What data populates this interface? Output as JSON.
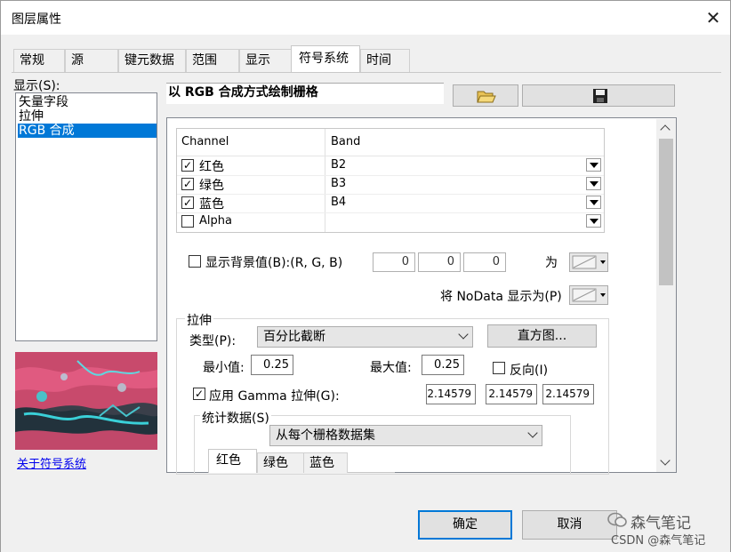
{
  "window": {
    "title": "图层属性",
    "close_glyph": "✕"
  },
  "tabs": [
    "常规",
    "源",
    "键元数据",
    "范围",
    "显示",
    "符号系统",
    "时间"
  ],
  "active_tab": "符号系统",
  "show": {
    "label": "显示(S):",
    "items": [
      "矢量字段",
      "拉伸",
      "RGB 合成"
    ],
    "selected": "RGB 合成"
  },
  "about_link": "关于符号系统",
  "heading": "以 RGB 合成方式绘制栅格",
  "toolbar": {
    "open_icon": "folder-open-icon",
    "save_icon": "save-icon"
  },
  "channels": {
    "col_channel": "Channel",
    "col_band": "Band",
    "rows": [
      {
        "name": "红色",
        "band": "B2",
        "checked": true
      },
      {
        "name": "绿色",
        "band": "B3",
        "checked": true
      },
      {
        "name": "蓝色",
        "band": "B4",
        "checked": true
      },
      {
        "name": "Alpha",
        "band": "",
        "checked": false
      }
    ]
  },
  "background": {
    "label": "显示背景值(B):(R, G, B)",
    "checked": false,
    "r": "0",
    "g": "0",
    "b": "0",
    "as_label": "为"
  },
  "nodata": {
    "label": "将 NoData 显示为(P)"
  },
  "stretch": {
    "group": "拉伸",
    "type_label": "类型(P):",
    "type_value": "百分比截断",
    "histogram_button": "直方图...",
    "min_label": "最小值:",
    "min_value": "0.25",
    "max_label": "最大值:",
    "max_value": "0.25",
    "invert_label": "反向(I)",
    "invert_checked": false,
    "gamma_label": "应用 Gamma 拉伸(G):",
    "gamma_checked": true,
    "gamma_values": [
      "2.14579",
      "2.14579",
      "2.14579"
    ]
  },
  "stats": {
    "group": "统计数据(S)",
    "source": "从每个栅格数据集",
    "tabs": [
      "红色",
      "绿色",
      "蓝色"
    ],
    "active_tab": "红色"
  },
  "footer": {
    "ok": "确定",
    "cancel": "取消"
  },
  "watermark": {
    "logo": "森气笔记",
    "credit": "CSDN @森气笔记"
  }
}
